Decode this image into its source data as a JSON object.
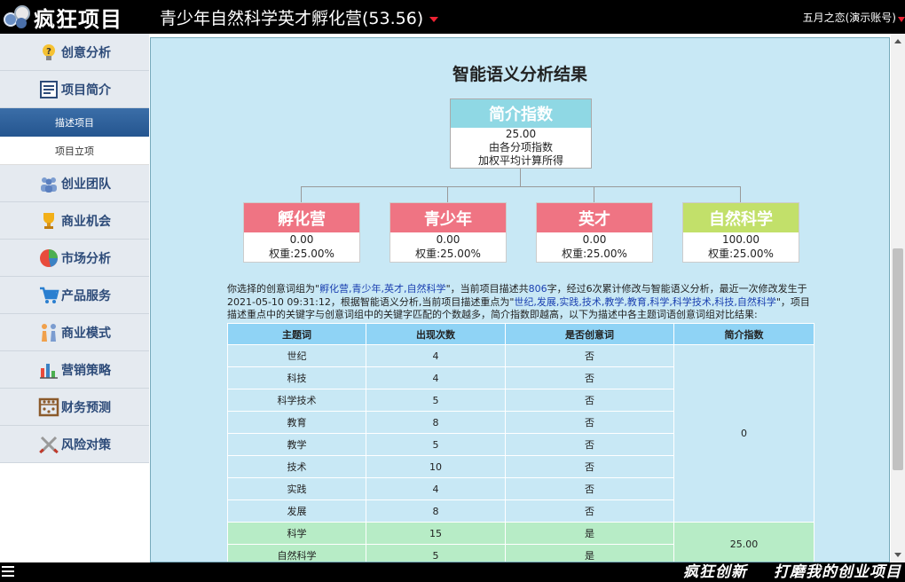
{
  "app": {
    "logo_text": "疯狂项目",
    "project_title": "青少年自然科学英才孵化营(53.56)",
    "user": "五月之恋(演示账号)"
  },
  "sidebar": {
    "items": [
      {
        "label": "创意分析",
        "icon": "lightbulb-icon"
      },
      {
        "label": "项目简介",
        "icon": "document-icon"
      }
    ],
    "sub_items": [
      {
        "label": "描述项目",
        "active": true
      },
      {
        "label": "项目立项",
        "active": false
      }
    ],
    "items_after": [
      {
        "label": "创业团队",
        "icon": "team-icon"
      },
      {
        "label": "商业机会",
        "icon": "trophy-icon"
      },
      {
        "label": "市场分析",
        "icon": "pie-chart-icon"
      },
      {
        "label": "产品服务",
        "icon": "cart-icon"
      },
      {
        "label": "商业模式",
        "icon": "people-icon"
      },
      {
        "label": "营销策略",
        "icon": "bar-chart-icon"
      },
      {
        "label": "财务预测",
        "icon": "abacus-icon"
      },
      {
        "label": "风险对策",
        "icon": "crossed-swords-icon"
      }
    ]
  },
  "main": {
    "title": "智能语义分析结果",
    "summary": {
      "header": "简介指数",
      "value": "25.00",
      "line1": "由各分项指数",
      "line2": "加权平均计算所得"
    },
    "keywords": [
      {
        "name": "孵化营",
        "value": "0.00",
        "weight": "权重:25.00%",
        "color": "red"
      },
      {
        "name": "青少年",
        "value": "0.00",
        "weight": "权重:25.00%",
        "color": "red"
      },
      {
        "name": "英才",
        "value": "0.00",
        "weight": "权重:25.00%",
        "color": "red"
      },
      {
        "name": "自然科学",
        "value": "100.00",
        "weight": "权重:25.00%",
        "color": "green"
      }
    ],
    "description": {
      "p1": "你选择的创意词组为\"",
      "kw_group": "孵化营,青少年,英才,自然科学",
      "p2": "\"，当前项目描述共",
      "char_count": "806",
      "p3": "字，经过6次累计修改与智能语义分析，最近一次修改发生于2021-05-10 09:31:12，根据智能语义分析,当前项目描述重点为\"",
      "kw_focus": "世纪,发展,实践,技术,教学,教育,科学,科学技术,科技,自然科学",
      "p4": "\"，项目描述重点中的关键字与创意词组中的关键字匹配的个数越多，简介指数即越高，以下为描述中各主题词语创意词组对比结果:"
    },
    "table": {
      "headers": [
        "主题词",
        "出现次数",
        "是否创意词",
        "简介指数"
      ],
      "rows": [
        {
          "word": "世纪",
          "count": "4",
          "is_creative": "否"
        },
        {
          "word": "科技",
          "count": "4",
          "is_creative": "否"
        },
        {
          "word": "科学技术",
          "count": "5",
          "is_creative": "否"
        },
        {
          "word": "教育",
          "count": "8",
          "is_creative": "否"
        },
        {
          "word": "教学",
          "count": "5",
          "is_creative": "否"
        },
        {
          "word": "技术",
          "count": "10",
          "is_creative": "否"
        },
        {
          "word": "实践",
          "count": "4",
          "is_creative": "否"
        },
        {
          "word": "发展",
          "count": "8",
          "is_creative": "否"
        },
        {
          "word": "科学",
          "count": "15",
          "is_creative": "是"
        },
        {
          "word": "自然科学",
          "count": "5",
          "is_creative": "是"
        }
      ],
      "index_no": "0",
      "index_yes": "25.00"
    }
  },
  "footer": {
    "slogan_a": "疯狂创新",
    "slogan_b": "打磨我的创业项目"
  }
}
